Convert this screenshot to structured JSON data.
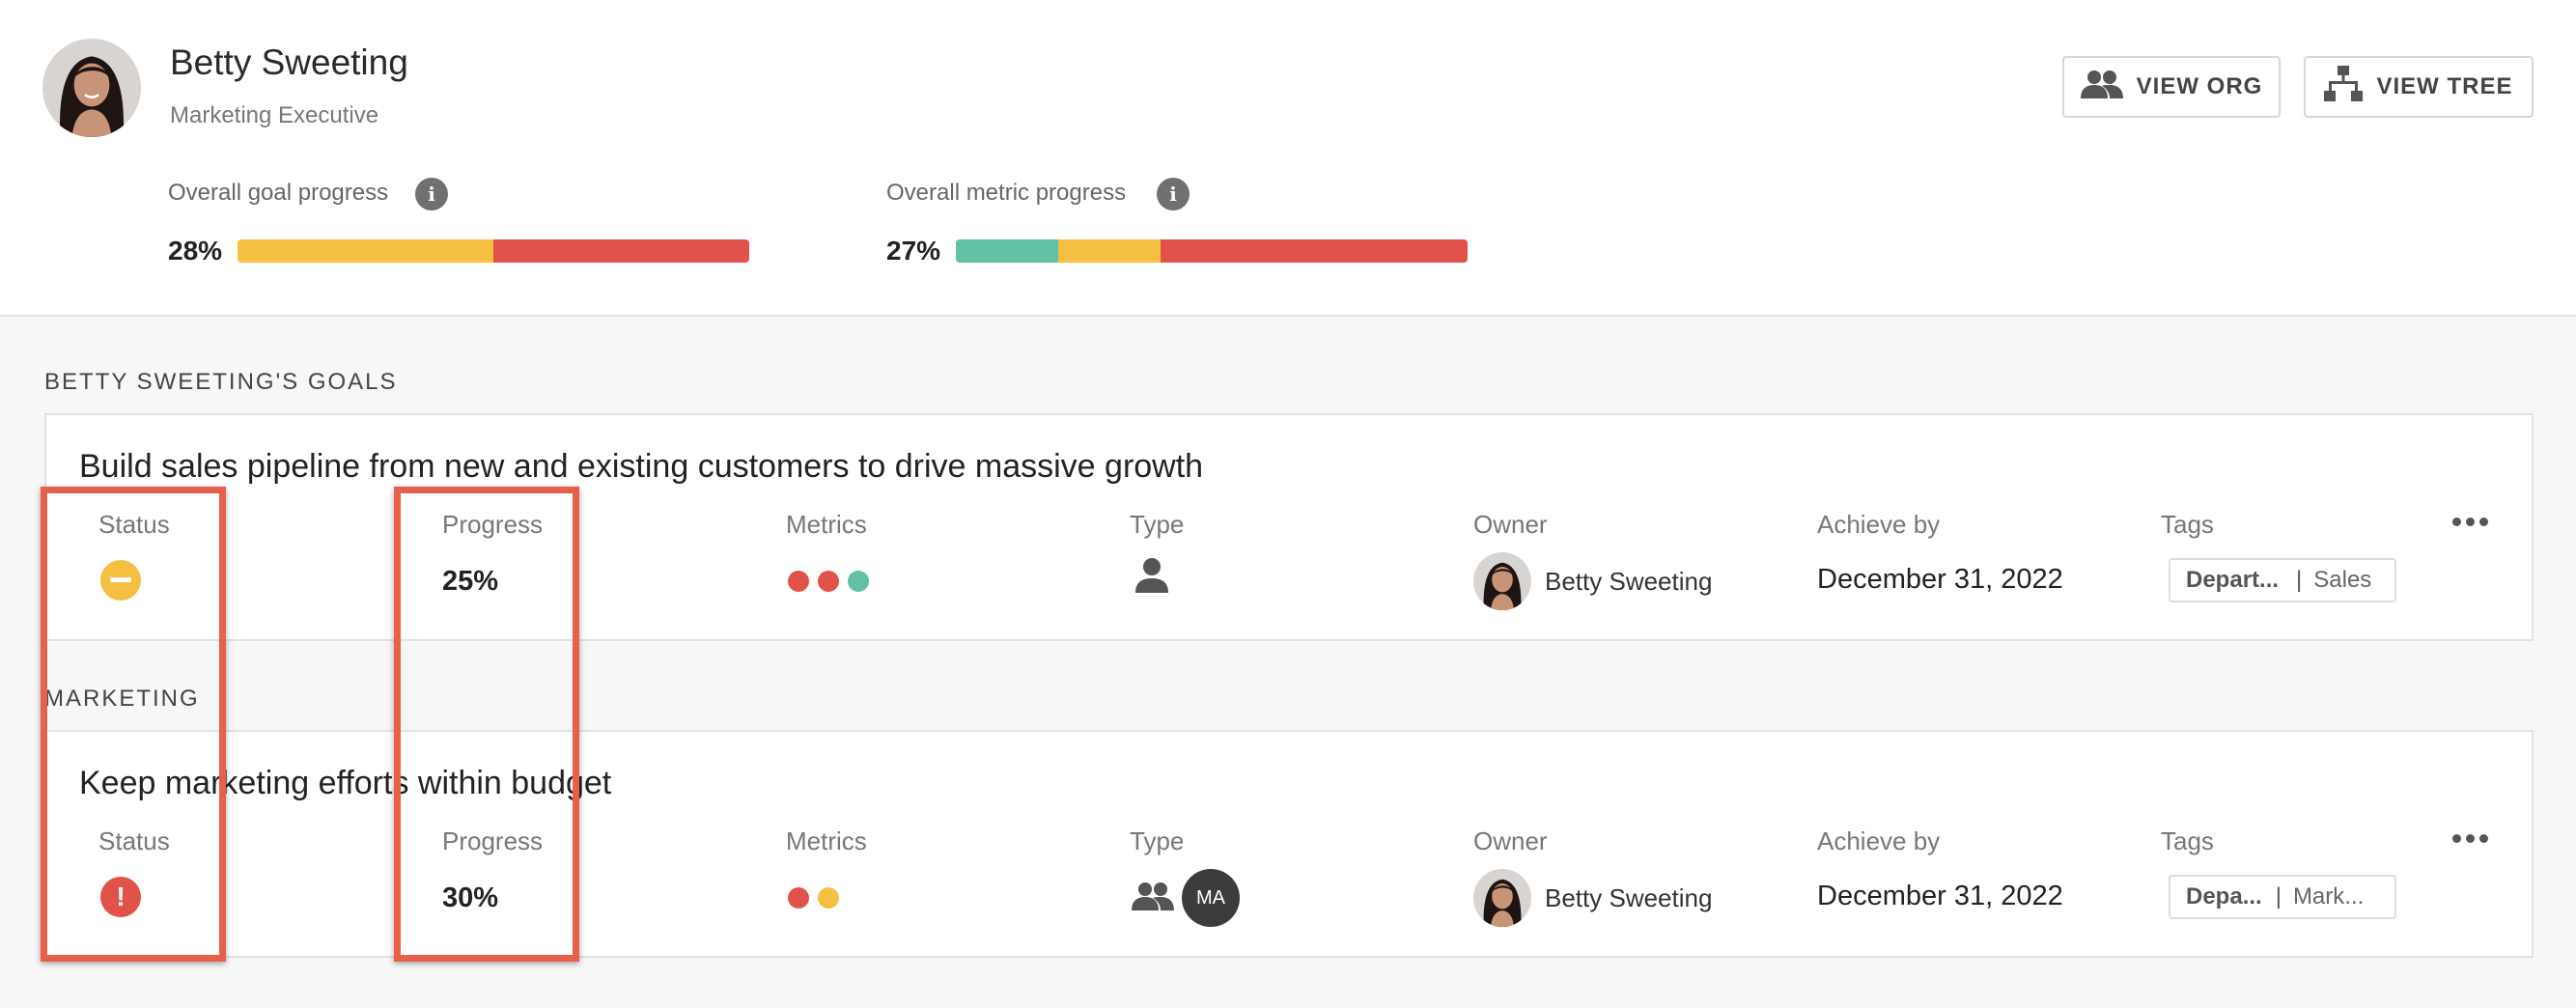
{
  "profile": {
    "name": "Betty Sweeting",
    "role": "Marketing Executive"
  },
  "header_buttons": {
    "view_org": "VIEW ORG",
    "view_tree": "VIEW TREE"
  },
  "overall": {
    "goal": {
      "label": "Overall goal progress",
      "percent": "28%",
      "segments": [
        {
          "color": "#f5bf42",
          "fraction": 0.5
        },
        {
          "color": "#e0524a",
          "fraction": 0.5
        }
      ]
    },
    "metric": {
      "label": "Overall metric progress",
      "percent": "27%",
      "segments": [
        {
          "color": "#62c1a5",
          "fraction": 0.2
        },
        {
          "color": "#f5bf42",
          "fraction": 0.2
        },
        {
          "color": "#e0524a",
          "fraction": 0.6
        }
      ]
    }
  },
  "columns": {
    "status": "Status",
    "progress": "Progress",
    "metrics": "Metrics",
    "type": "Type",
    "owner": "Owner",
    "achieve_by": "Achieve by",
    "tags": "Tags"
  },
  "sections": [
    {
      "title": "BETTY SWEETING'S GOALS",
      "goal": {
        "title": "Build sales pipeline from new and existing customers to drive massive growth",
        "status": "on-hold",
        "status_color": "#f5bf42",
        "progress": "25%",
        "metric_dots": [
          "#e0524a",
          "#e0524a",
          "#62c1a5"
        ],
        "type_icon": "person-icon",
        "owner": "Betty Sweeting",
        "achieve_by": "December 31, 2022",
        "tag_key": "Depart...",
        "tag_value": "Sales"
      }
    },
    {
      "title": "MARKETING",
      "goal": {
        "title": "Keep marketing efforts within budget",
        "status": "at-risk",
        "status_color": "#e0524a",
        "progress": "30%",
        "metric_dots": [
          "#e0524a",
          "#f5bf42"
        ],
        "type_icon": "group-icon",
        "type_badge": "MA",
        "owner": "Betty Sweeting",
        "achieve_by": "December 31, 2022",
        "tag_key": "Depa...",
        "tag_value": "Mark..."
      }
    }
  ]
}
